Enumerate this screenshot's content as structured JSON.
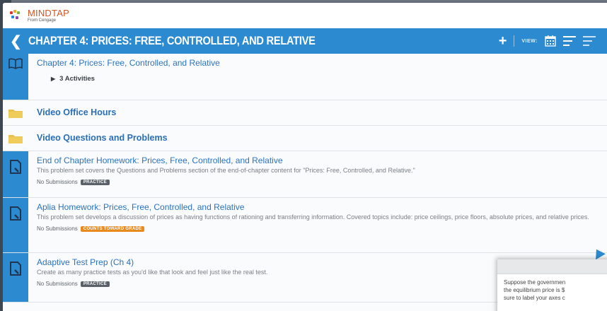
{
  "brand": {
    "name": "MINDTAP",
    "sub": "From Cengage"
  },
  "chapter": {
    "title": "CHAPTER 4: PRICES: FREE, CONTROLLED, AND RELATIVE",
    "view_label": "VIEW:"
  },
  "items": [
    {
      "type": "book",
      "title": "Chapter 4: Prices: Free, Controlled, and Relative",
      "activities": "3 Activities"
    },
    {
      "type": "folder",
      "title": "Video Office Hours"
    },
    {
      "type": "folder",
      "title": "Video Questions and Problems"
    },
    {
      "type": "assignment",
      "title": "End of Chapter Homework: Prices, Free, Controlled, and Relative",
      "description": "This problem set covers the Questions and Problems section of the end-of-chapter content for \"Prices: Free, Controlled, and Relative.\"",
      "status": "No Submissions",
      "badge": "PRACTICE"
    },
    {
      "type": "assignment",
      "title": "Aplia Homework: Prices, Free, Controlled, and Relative",
      "description": "This problem set develops a discussion of prices as having functions of rationing and transferring information. Covered topics include: price ceilings, price floors, absolute prices, and relative prices.",
      "status": "No Submissions",
      "badge": "COUNTS TOWARD GRADE"
    },
    {
      "type": "assignment",
      "title": "Adaptive Test Prep (Ch 4)",
      "description": "Create as many practice tests as you'd like that look and feel just like the real test.",
      "status": "No Submissions",
      "badge": "PRACTICE"
    }
  ],
  "popup": {
    "line1": "Suppose the governmen",
    "line2": "the equilibrium price is $",
    "line3": "sure to label your axes c"
  },
  "colors": {
    "accent": "#2c8bd0",
    "brand": "#d3531f",
    "link": "#2a73c0",
    "folder": "#e8c14a",
    "grade_badge": "#e98a1f"
  }
}
